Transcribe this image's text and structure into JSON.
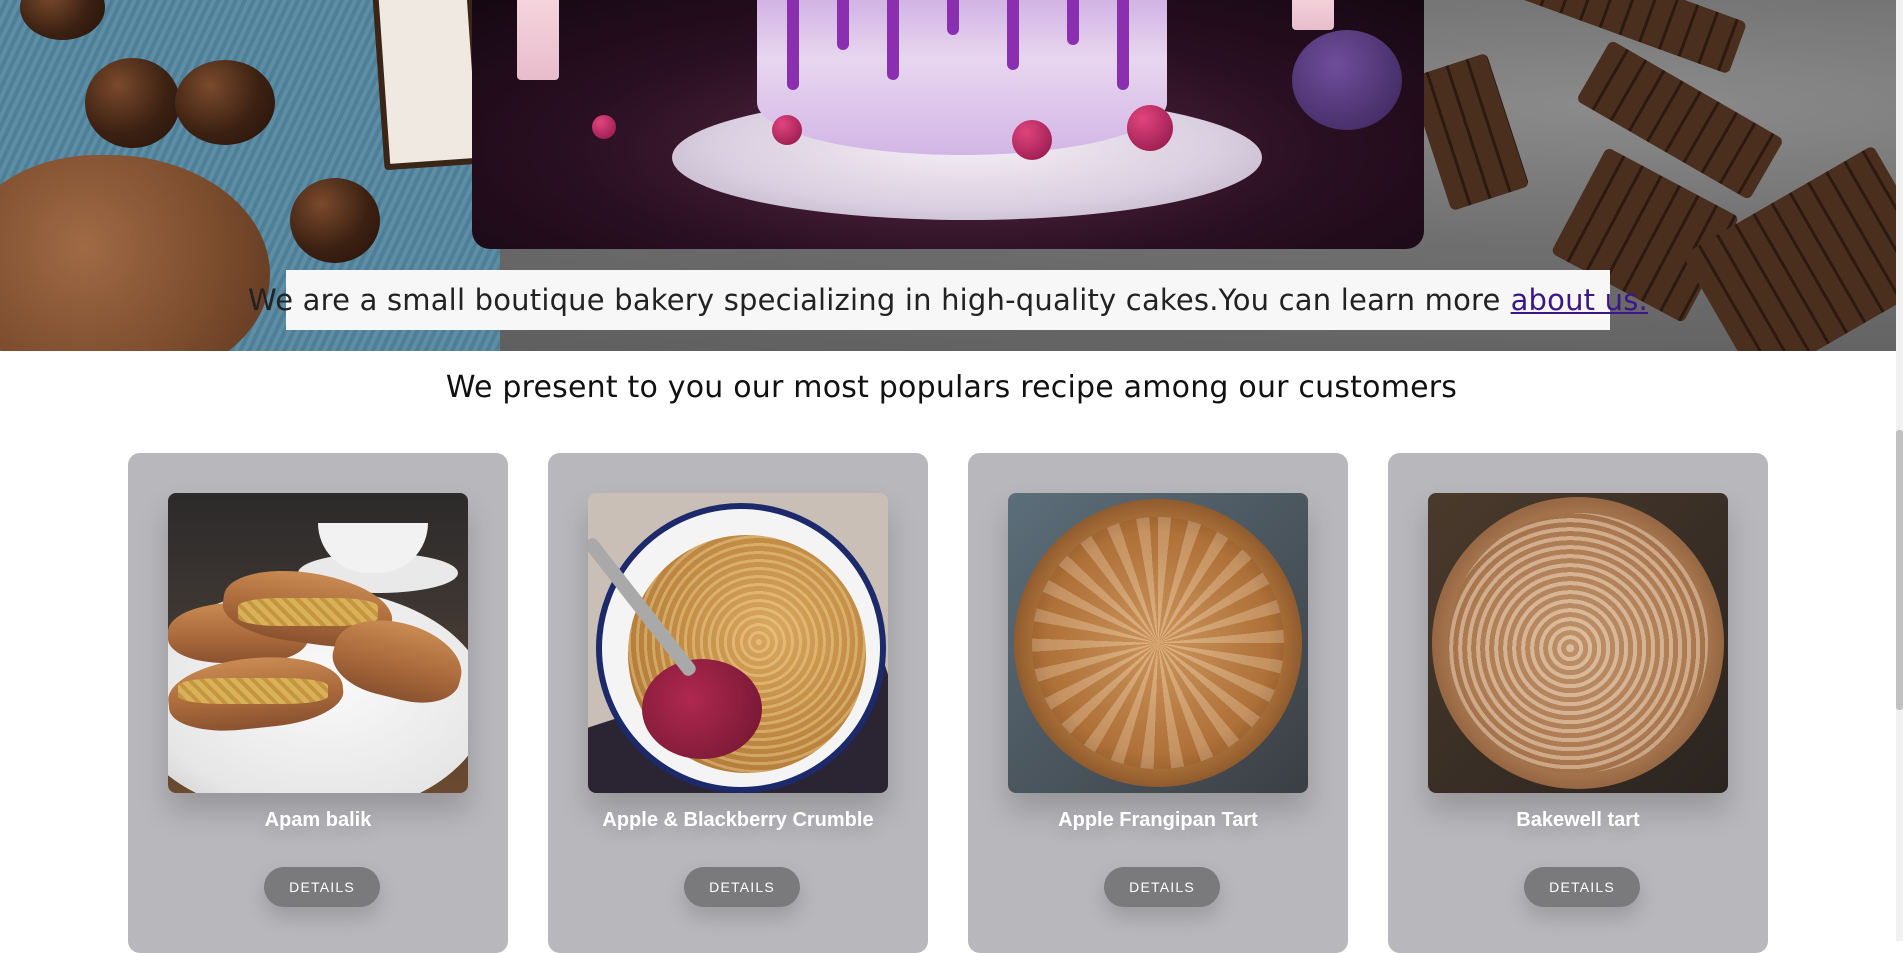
{
  "hero": {
    "intro_text": "We are a small boutique bakery specializing in high-quality cakes.You can learn more",
    "about_link": "about us."
  },
  "section": {
    "title": "We present to you our most populars recipe among our customers"
  },
  "recipes": [
    {
      "name": "Apam balik",
      "button": "DETAILS"
    },
    {
      "name": "Apple & Blackberry Crumble",
      "button": "DETAILS"
    },
    {
      "name": "Apple Frangipan Tart",
      "button": "DETAILS"
    },
    {
      "name": "Bakewell tart",
      "button": "DETAILS"
    }
  ],
  "colors": {
    "card_bg": "#b8b8bc",
    "button_bg": "#7a7a7c",
    "link": "#3b1788"
  }
}
